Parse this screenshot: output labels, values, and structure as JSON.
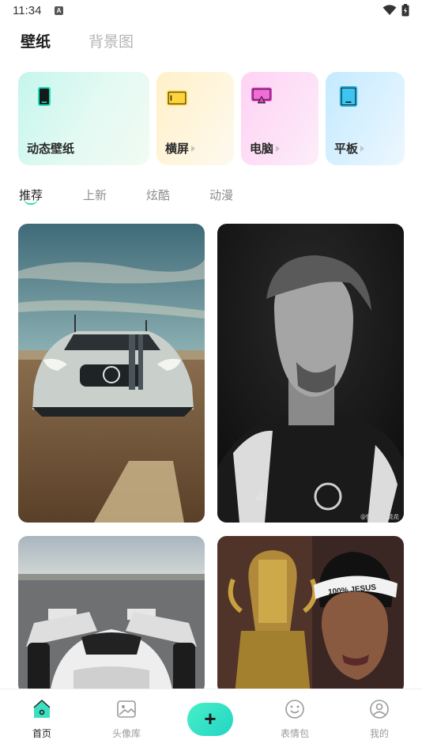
{
  "status_bar": {
    "time": "11:34",
    "notification_icon": "a-letter-icon",
    "wifi_icon": "wifi-icon",
    "battery_icon": "battery-icon"
  },
  "top_tabs": [
    {
      "label": "壁纸",
      "active": true
    },
    {
      "label": "背景图",
      "active": false
    }
  ],
  "categories": [
    {
      "label": "动态壁纸",
      "icon": "phone-icon",
      "color": "#1fd6b4"
    },
    {
      "label": "横屏",
      "icon": "landscape-icon",
      "color": "#ffd43b"
    },
    {
      "label": "电脑",
      "icon": "desktop-icon",
      "color": "#e840c8"
    },
    {
      "label": "平板",
      "icon": "tablet-icon",
      "color": "#26b4e6"
    }
  ],
  "sub_tabs": [
    {
      "label": "推荐",
      "active": true
    },
    {
      "label": "上新",
      "active": false
    },
    {
      "label": "炫酷",
      "active": false
    },
    {
      "label": "动漫",
      "active": false
    }
  ],
  "wallpapers": [
    {
      "subject": "car-wallpaper"
    },
    {
      "subject": "football-player-wallpaper",
      "watermark": "@懂小球的花花"
    },
    {
      "subject": "supercar-runway-wallpaper"
    },
    {
      "subject": "trophy-player-wallpaper",
      "headband_text": "100% JESUS"
    }
  ],
  "bottom_nav": {
    "home": "首页",
    "avatar_library": "头像库",
    "add": "+",
    "stickers": "表情包",
    "profile": "我的"
  },
  "colors": {
    "accent": "#34d9b6",
    "add_button": "#2ee0c6"
  }
}
